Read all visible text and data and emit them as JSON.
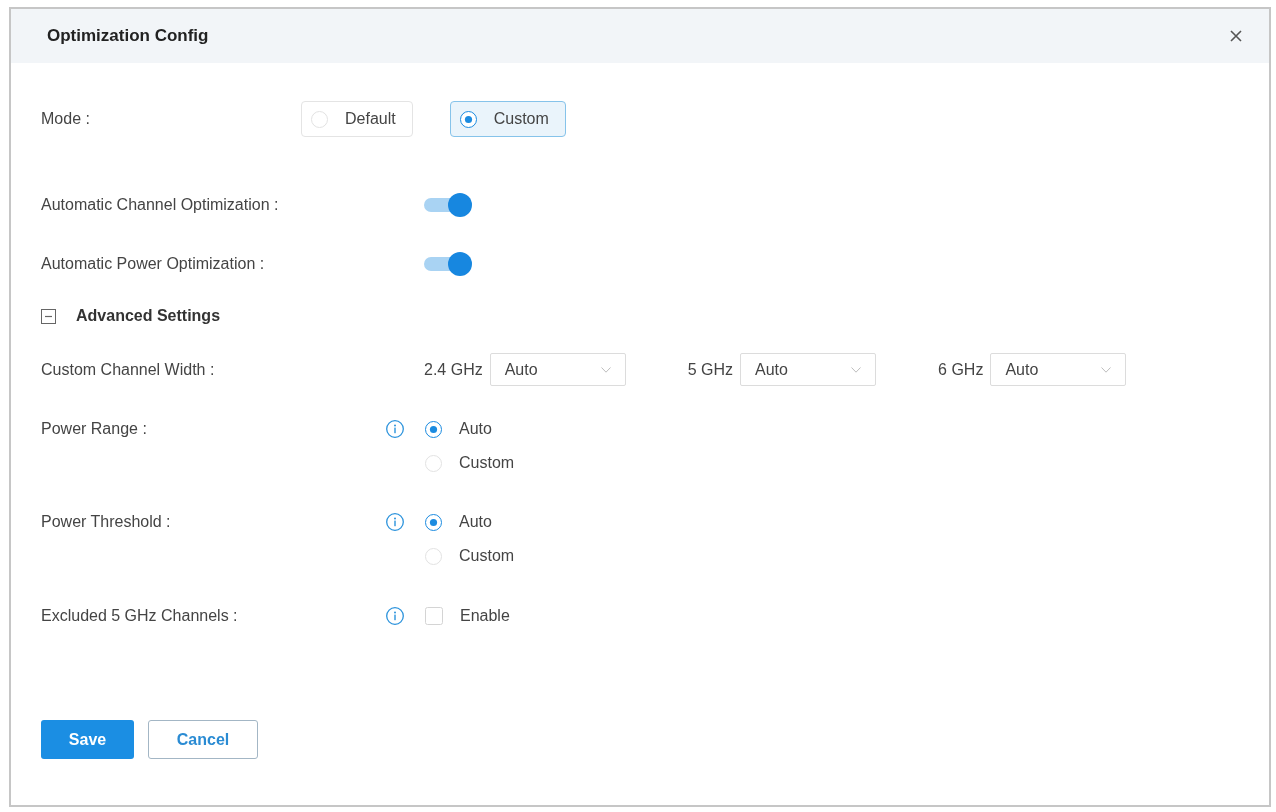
{
  "dialog": {
    "title": "Optimization Config"
  },
  "mode": {
    "label": "Mode :",
    "options": [
      {
        "label": "Default",
        "selected": false
      },
      {
        "label": "Custom",
        "selected": true
      }
    ]
  },
  "toggles": [
    {
      "label": "Automatic Channel Optimization :",
      "on": true
    },
    {
      "label": "Automatic Power Optimization :",
      "on": true
    }
  ],
  "advanced": {
    "title": "Advanced Settings",
    "expanded": true,
    "channel_width": {
      "label": "Custom Channel Width :",
      "bands": [
        {
          "band": "2.4 GHz",
          "value": "Auto"
        },
        {
          "band": "5 GHz",
          "value": "Auto"
        },
        {
          "band": "6 GHz",
          "value": "Auto"
        }
      ]
    },
    "radio_groups": [
      {
        "label": "Power Range :",
        "options": [
          {
            "label": "Auto",
            "selected": true
          },
          {
            "label": "Custom",
            "selected": false
          }
        ]
      },
      {
        "label": "Power Threshold :",
        "options": [
          {
            "label": "Auto",
            "selected": true
          },
          {
            "label": "Custom",
            "selected": false
          }
        ]
      }
    ],
    "excluded_channels": {
      "label": "Excluded 5 GHz Channels :",
      "option": {
        "label": "Enable",
        "checked": false
      }
    }
  },
  "buttons": [
    {
      "label": "Save",
      "kind": "primary"
    },
    {
      "label": "Cancel",
      "kind": "secondary"
    }
  ]
}
